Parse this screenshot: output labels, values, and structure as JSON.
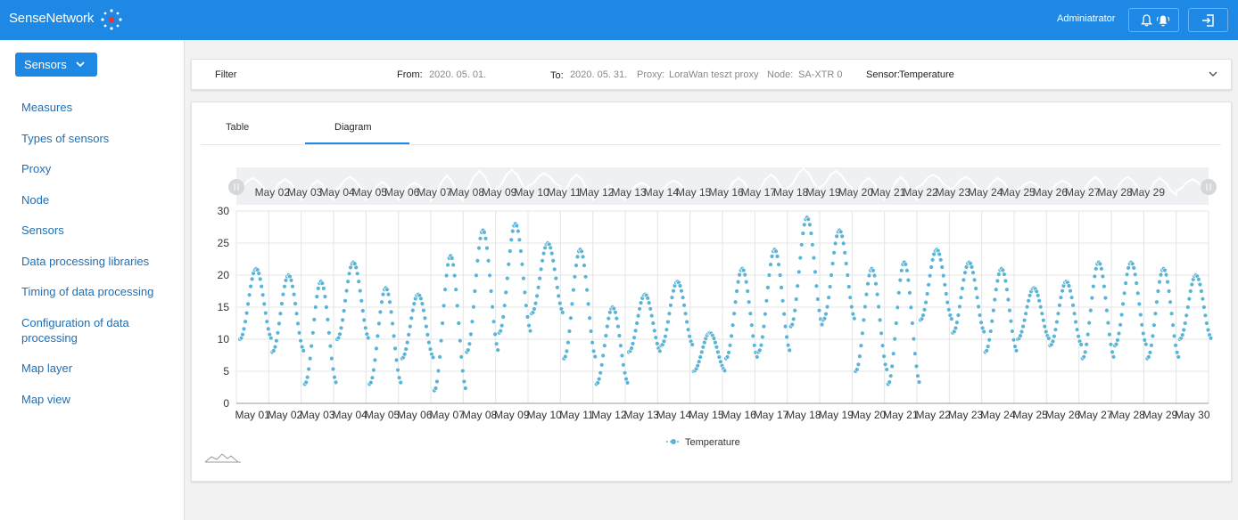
{
  "header": {
    "brand": "SenseNetwork",
    "logo_icon": "network-logo-icon",
    "user": "Adminiatrator",
    "notifications_icon": "bell-icon",
    "alert_icon": "alarm-bell-icon",
    "logout_icon": "logout-icon"
  },
  "sidebar": {
    "dropdown_label": "Sensors",
    "items": [
      {
        "label": "Measures"
      },
      {
        "label": "Types of sensors"
      },
      {
        "label": "Proxy"
      },
      {
        "label": "Node"
      },
      {
        "label": "Sensors"
      },
      {
        "label": "Data processing libraries"
      },
      {
        "label": "Timing of data processing"
      },
      {
        "label": "Configuration of data processing"
      },
      {
        "label": "Map layer"
      },
      {
        "label": "Map view"
      }
    ]
  },
  "filter": {
    "title": "Filter",
    "from_label": "From:",
    "from_value": "2020. 05. 01.",
    "to_label": "To:",
    "to_value": "2020. 05. 31.",
    "proxy_label": "Proxy:",
    "proxy_value": "LoraWan teszt proxy",
    "node_label": "Node:",
    "node_value": "SA-XTR 0",
    "sensor_label": "Sensor:",
    "sensor_value": "Temperature"
  },
  "tabs": [
    {
      "label": "Table",
      "active": false
    },
    {
      "label": "Diagram",
      "active": true
    }
  ],
  "colors": {
    "accent": "#1e88e5",
    "series": "#5ab4d6"
  },
  "chart_data": {
    "type": "scatter",
    "ylim": [
      0,
      30
    ],
    "y_ticks": [
      0,
      5,
      10,
      15,
      20,
      25,
      30
    ],
    "x_ticks": [
      "May 01",
      "May 02",
      "May 03",
      "May 04",
      "May 05",
      "May 06",
      "May 07",
      "May 08",
      "May 09",
      "May 10",
      "May 11",
      "May 12",
      "May 13",
      "May 14",
      "May 15",
      "May 16",
      "May 17",
      "May 18",
      "May 19",
      "May 20",
      "May 21",
      "May 22",
      "May 23",
      "May 24",
      "May 25",
      "May 26",
      "May 27",
      "May 28",
      "May 29",
      "May 30"
    ],
    "slider_ticks": [
      "May 02",
      "May 03",
      "May 04",
      "May 05",
      "May 06",
      "May 07",
      "May 08",
      "May 09",
      "May 10",
      "May 11",
      "May 12",
      "May 13",
      "May 14",
      "May 15",
      "May 16",
      "May 17",
      "May 18",
      "May 19",
      "May 20",
      "May 21",
      "May 22",
      "May 23",
      "May 24",
      "May 25",
      "May 26",
      "May 27",
      "May 28",
      "May 29"
    ],
    "grid": true,
    "legend_position": "bottom",
    "series": [
      {
        "name": "Temperature",
        "x_unit": "day of May",
        "daily_min": [
          10,
          8,
          3,
          10,
          3,
          7,
          2,
          8,
          11,
          14,
          7,
          3,
          8,
          9,
          5,
          7,
          8,
          12,
          13,
          5,
          3,
          13,
          11,
          8,
          10,
          9,
          7,
          9,
          7,
          10
        ],
        "daily_max": [
          21,
          20,
          19,
          22,
          18,
          17,
          23,
          27,
          28,
          25,
          24,
          15,
          17,
          19,
          11,
          21,
          24,
          29,
          27,
          21,
          22,
          24,
          22,
          21,
          18,
          19,
          22,
          22,
          21,
          20
        ]
      }
    ]
  }
}
